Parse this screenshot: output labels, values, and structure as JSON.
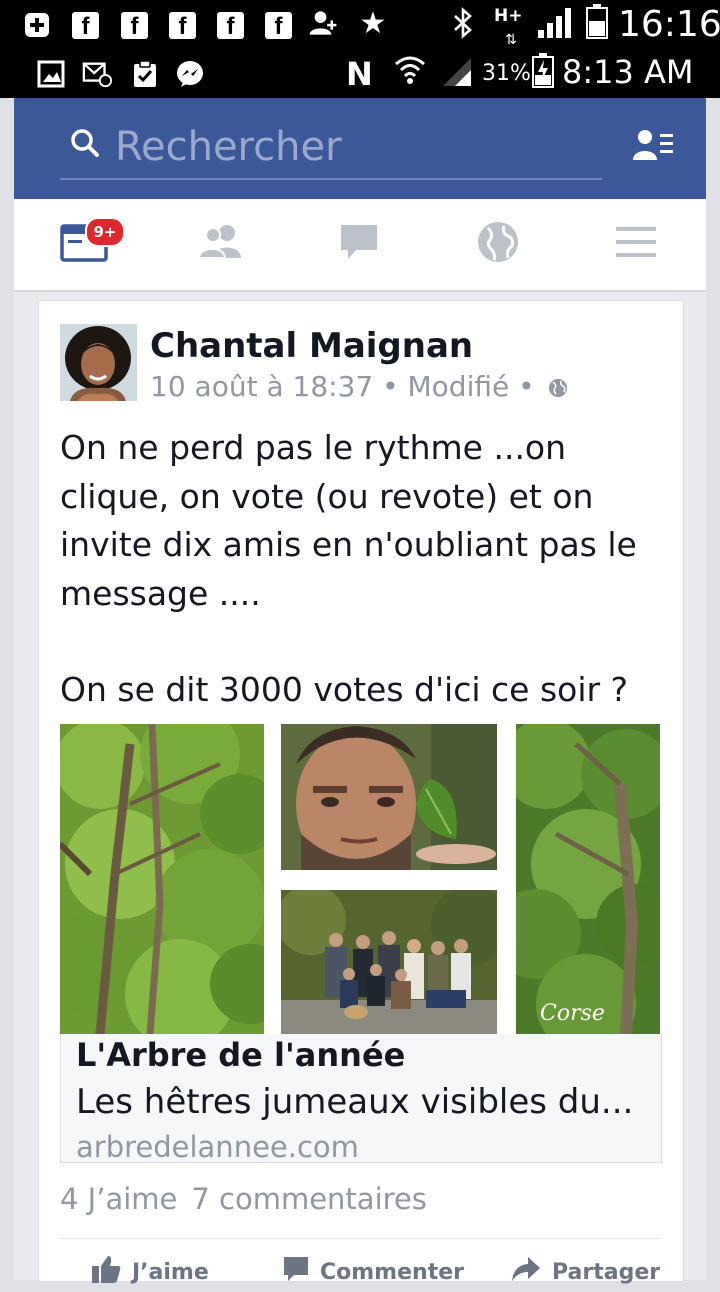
{
  "status_bar": {
    "time_top": "16:16",
    "network_top": "H+",
    "battery_pct": "31%",
    "time_bottom": "8:13 AM",
    "carrier_icon": "N"
  },
  "search": {
    "placeholder": "Rechercher"
  },
  "tabs": {
    "news_badge": "9+"
  },
  "post": {
    "author": "Chantal Maignan",
    "meta": "10 août à 18:37 • Modifié •",
    "text_lines": [
      "On ne perd pas le rythme ...on",
      "clique, on vote (ou revote) et on",
      "invite dix amis en n'oubliant pas le",
      "message ...."
    ],
    "text_second": "On se dit 3000 votes d'ici ce soir ?",
    "image_watermark": "Corse",
    "link": {
      "title": "L'Arbre de l'année",
      "description": "Les hêtres jumeaux visibles du...",
      "domain": "arbredelannee.com"
    },
    "likes": "4 J’aime",
    "comments": "7 commentaires",
    "actions": {
      "like": "J’aime",
      "comment": "Commenter",
      "share": "Partager"
    }
  },
  "colors": {
    "brand_blue": "#3b5998",
    "badge_red": "#e0272c",
    "muted_text": "#9197a3"
  },
  "icons": [
    "plus-square-icon",
    "facebook-icon",
    "add-friend-icon",
    "star-icon",
    "bluetooth-icon",
    "signal-icon",
    "battery-icon",
    "photo-icon",
    "email-icon",
    "clipboard-icon",
    "messenger-icon",
    "nfc-icon",
    "wifi-icon",
    "search-icon",
    "friend-list-icon",
    "news-feed-icon",
    "friends-icon",
    "messages-icon",
    "globe-icon",
    "menu-icon",
    "like-icon",
    "comment-icon",
    "share-icon"
  ]
}
